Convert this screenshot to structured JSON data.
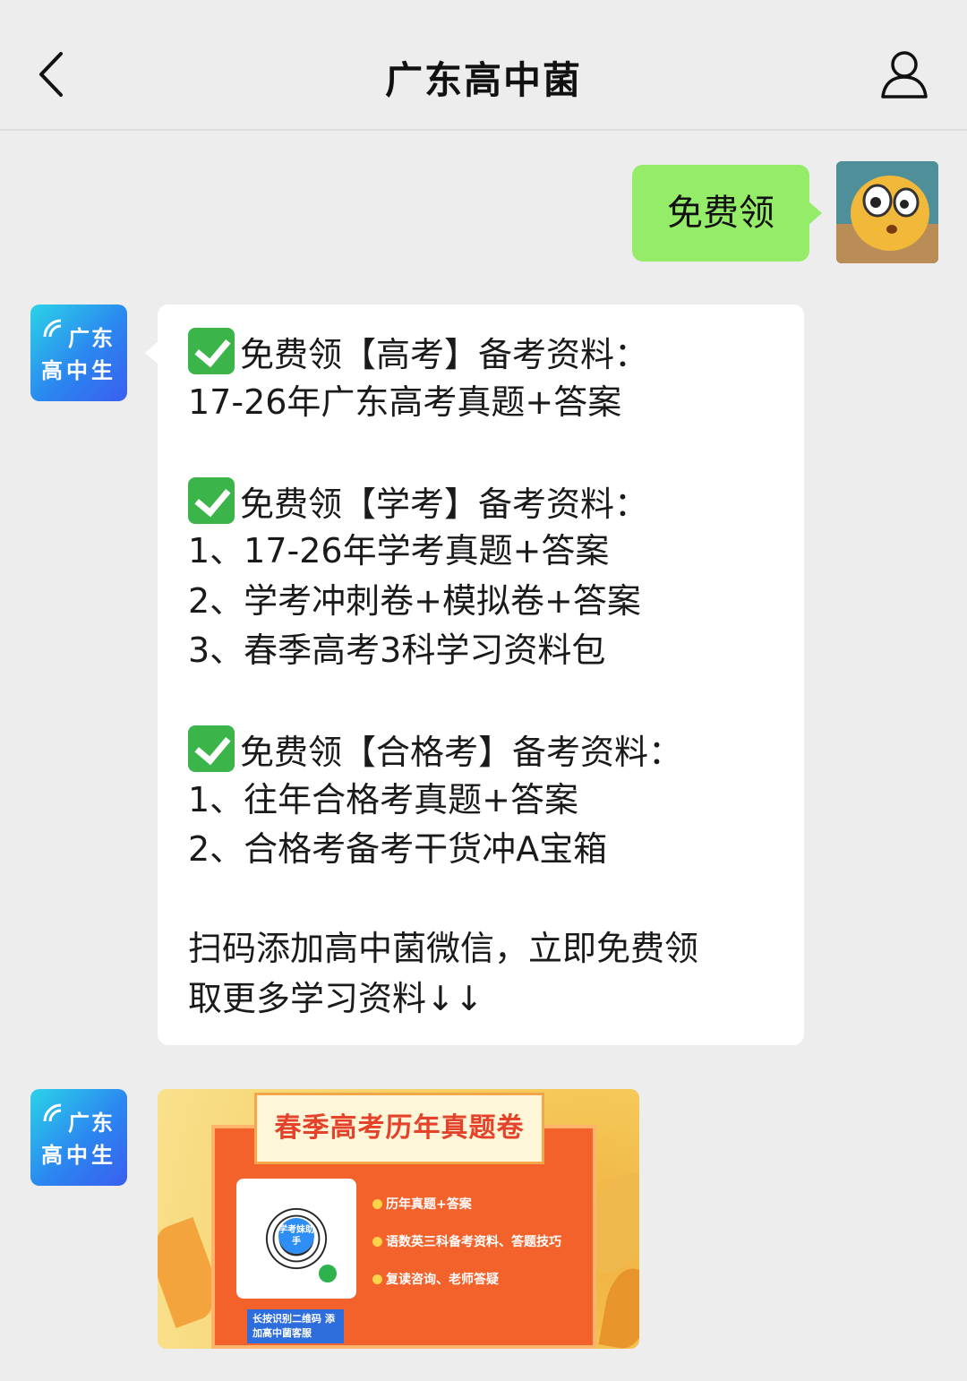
{
  "header": {
    "title": "广东高中菌"
  },
  "messages": {
    "outgoing_text": "免费领",
    "sender_avatar_text": {
      "line1": "广东",
      "line2": "高中生"
    },
    "main_message_lines": [
      "免费领【高考】备考资料：",
      "17-26年广东高考真题+答案",
      "",
      "免费领【学考】备考资料：",
      "1、17-26年学考真题+答案",
      "2、学考冲刺卷+模拟卷+答案",
      "3、春季高考3科学习资料包",
      "",
      "免费领【合格考】备考资料：",
      "1、往年合格考真题+答案",
      "2、合格考备考干货冲A宝箱",
      "",
      "扫码添加高中菌微信，立即免费领",
      "取更多学习资料↓↓"
    ],
    "poster": {
      "banner": "春季高考历年真题卷",
      "features": [
        "历年真题+答案",
        "语数英三科备考资料、答题技巧",
        "复读咨询、老师答疑"
      ],
      "qr_center": "学考妹助手",
      "qr_tip": "长按识别二维码 添加高中菌客服"
    }
  },
  "colors": {
    "outgoing_bubble": "#95ec69",
    "incoming_bubble": "#ffffff",
    "background": "#ededed",
    "check": "#3bb54a"
  }
}
